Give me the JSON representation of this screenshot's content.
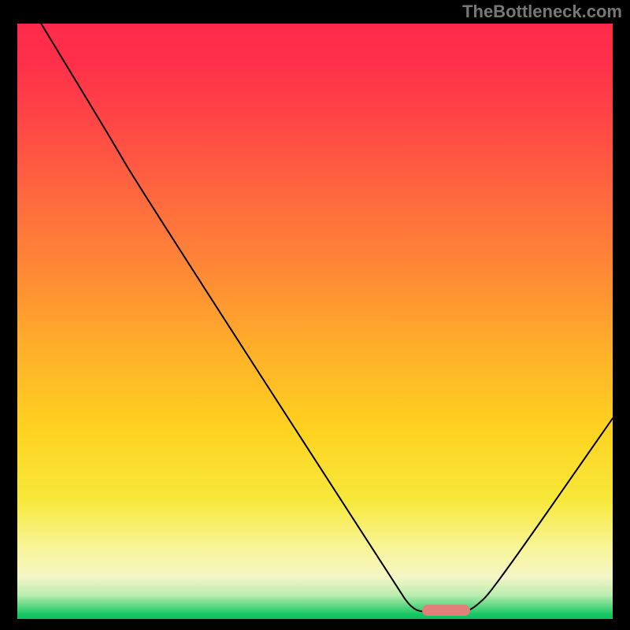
{
  "watermark": "TheBottleneck.com",
  "chart_data": {
    "type": "line",
    "title": "",
    "xlabel": "",
    "ylabel": "",
    "xlim": [
      0,
      100
    ],
    "ylim": [
      0,
      100
    ],
    "grid": false,
    "legend": false,
    "background_gradient": {
      "stops": [
        {
          "offset": 0.0,
          "color": "#ff2a4a"
        },
        {
          "offset": 0.06,
          "color": "#ff2f4a"
        },
        {
          "offset": 0.18,
          "color": "#ff4a45"
        },
        {
          "offset": 0.3,
          "color": "#ff6b3e"
        },
        {
          "offset": 0.42,
          "color": "#ff8a35"
        },
        {
          "offset": 0.55,
          "color": "#ffb02a"
        },
        {
          "offset": 0.68,
          "color": "#ffd220"
        },
        {
          "offset": 0.8,
          "color": "#f7e83a"
        },
        {
          "offset": 0.88,
          "color": "#f8f598"
        },
        {
          "offset": 0.93,
          "color": "#f4f6c6"
        },
        {
          "offset": 0.96,
          "color": "#b9edae"
        },
        {
          "offset": 0.978,
          "color": "#5fd883"
        },
        {
          "offset": 0.992,
          "color": "#17c765"
        },
        {
          "offset": 1.0,
          "color": "#0fc060"
        }
      ]
    },
    "series": [
      {
        "name": "bottleneck-curve",
        "points": [
          {
            "x": 4,
            "y": 100
          },
          {
            "x": 16,
            "y": 80
          },
          {
            "x": 20,
            "y": 73
          },
          {
            "x": 64,
            "y": 4
          },
          {
            "x": 66,
            "y": 1
          },
          {
            "x": 68,
            "y": 0
          },
          {
            "x": 75,
            "y": 0
          },
          {
            "x": 77,
            "y": 1
          },
          {
            "x": 80,
            "y": 4
          },
          {
            "x": 100,
            "y": 33
          }
        ]
      }
    ],
    "annotations": [
      {
        "name": "optimal-range-marker",
        "type": "rounded-bar",
        "x_start": 68,
        "x_end": 76,
        "y": 0,
        "color": "#e08078"
      }
    ],
    "axes_visible": false
  }
}
